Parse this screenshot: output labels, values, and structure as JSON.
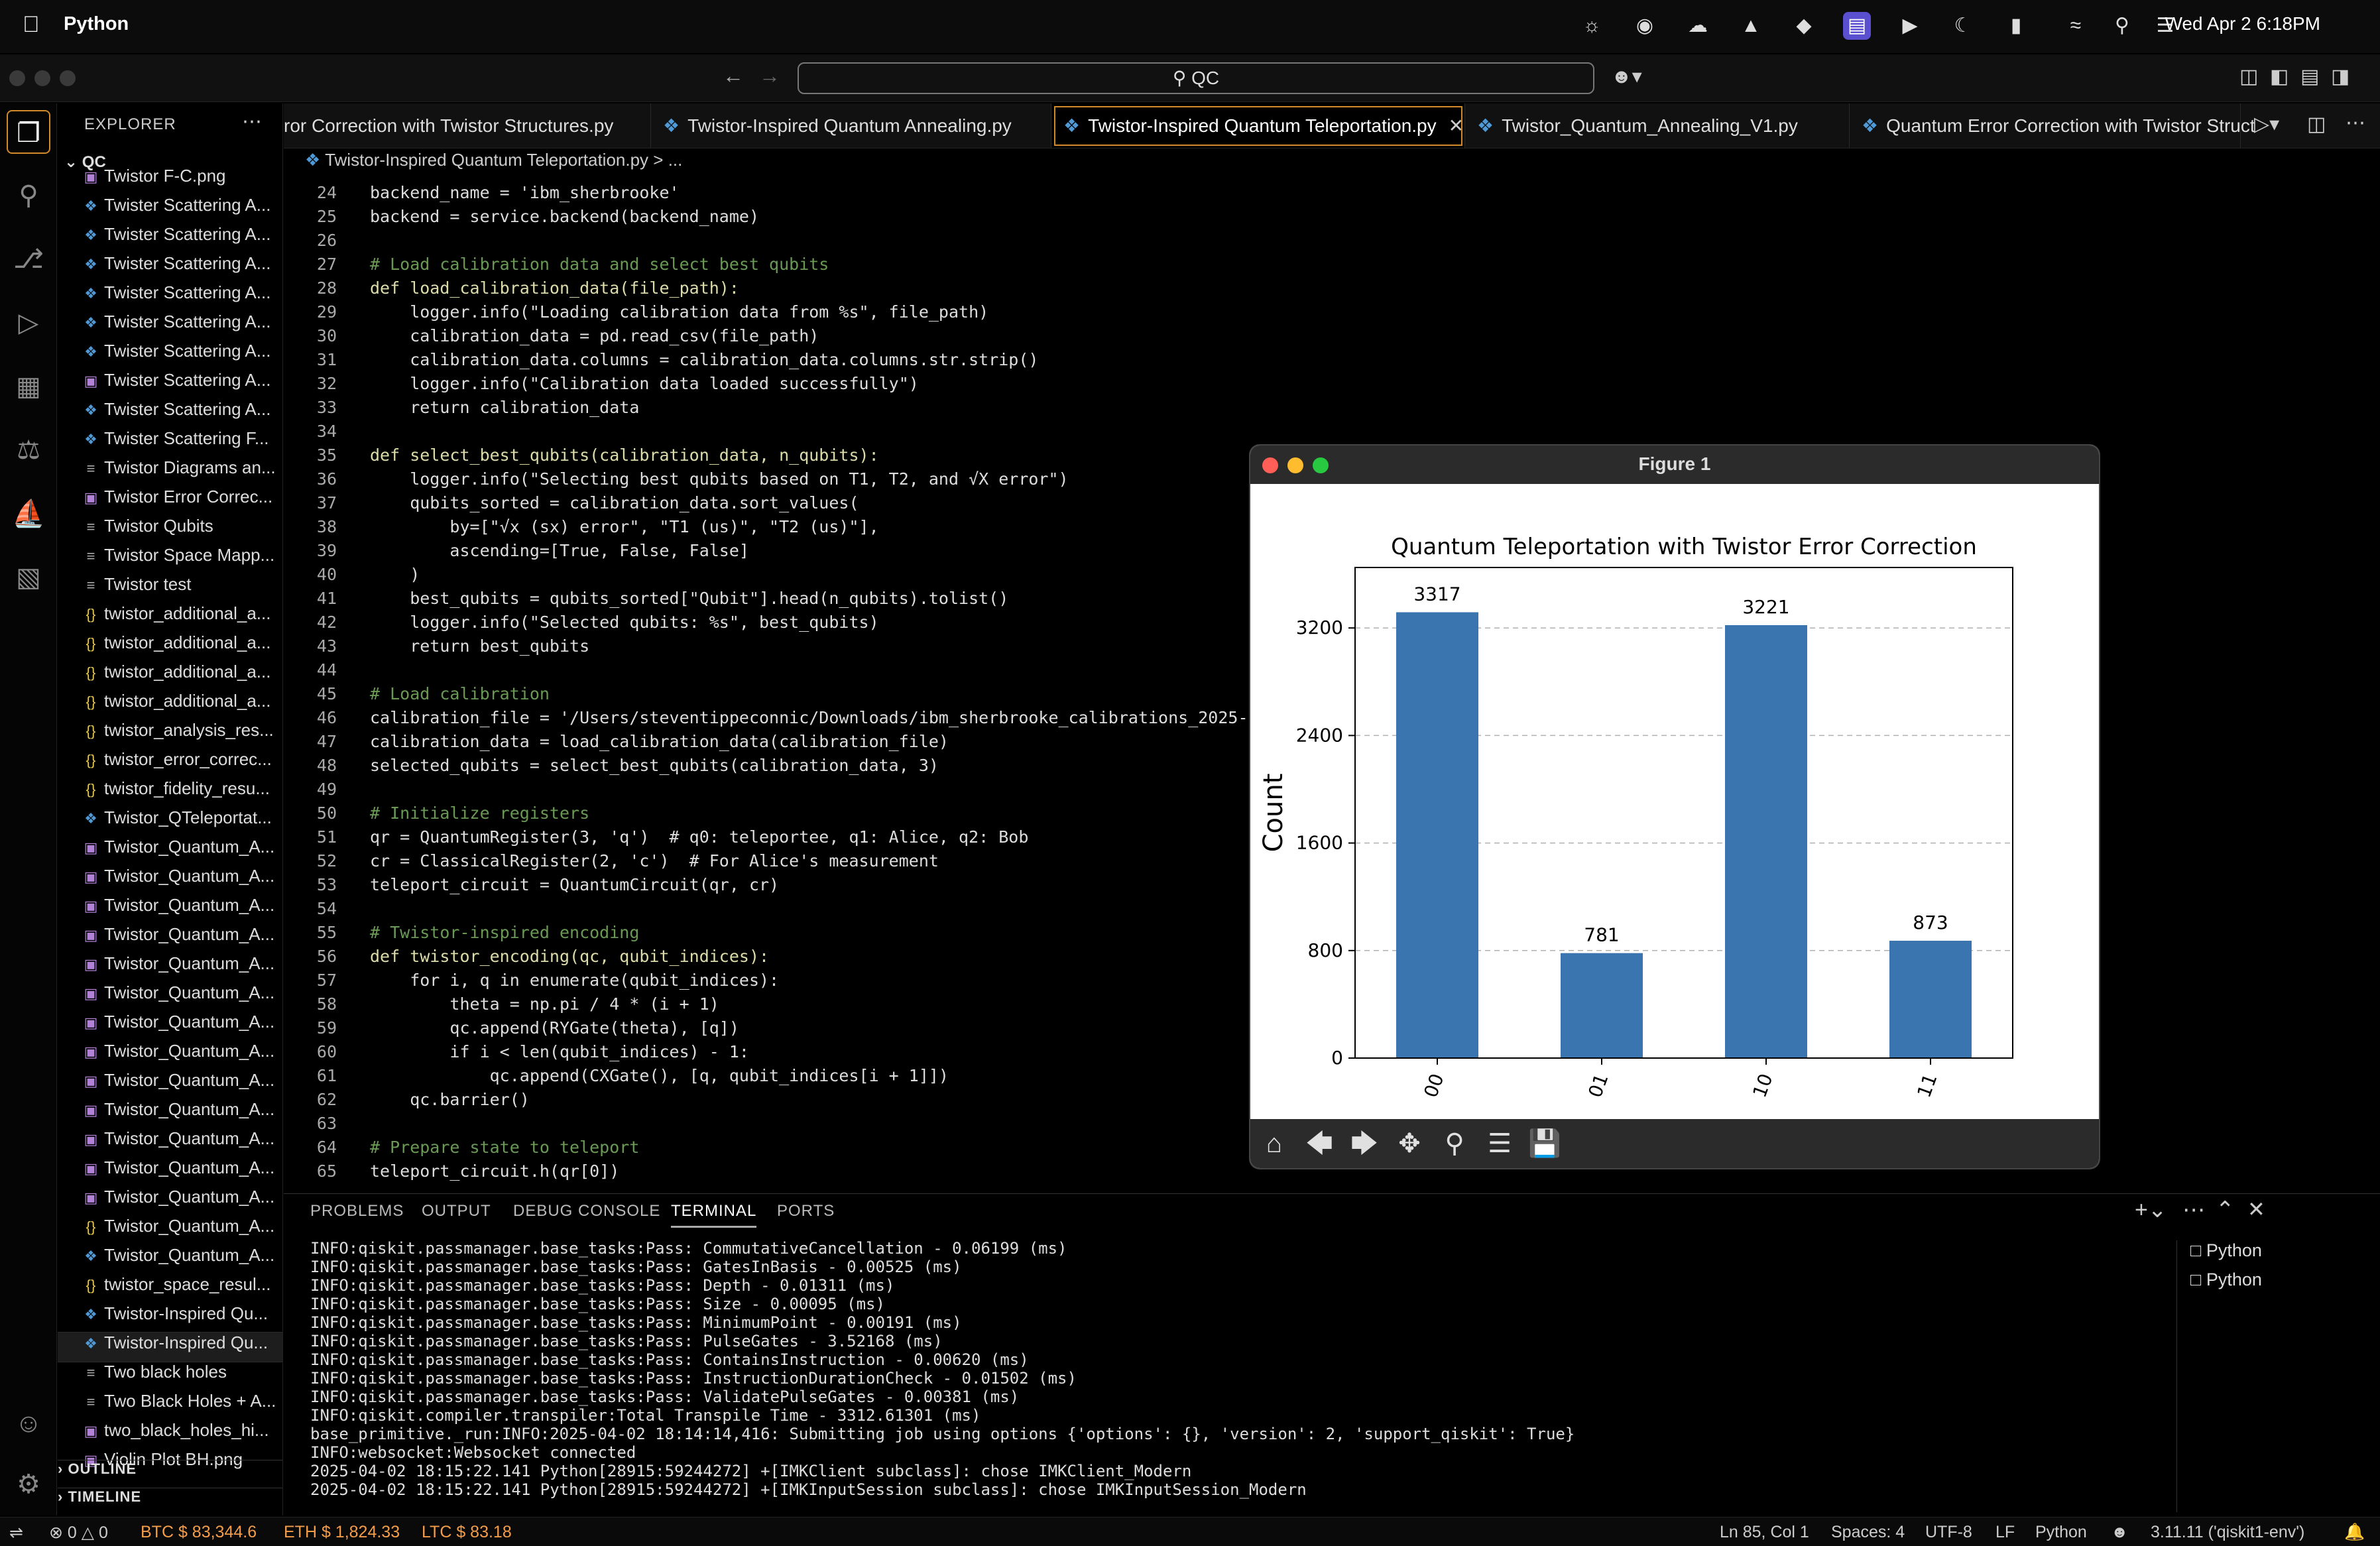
{
  "menubar": {
    "app_name": "Python",
    "clock": "Wed Apr 2  6:18PM"
  },
  "command_center": {
    "query": "QC"
  },
  "explorer": {
    "header": "EXPLORER",
    "root": "QC",
    "files": [
      {
        "name": "Twistor F-C.png",
        "type": "img"
      },
      {
        "name": "Twister Scattering A...",
        "type": "py"
      },
      {
        "name": "Twister Scattering A...",
        "type": "py"
      },
      {
        "name": "Twister Scattering A...",
        "type": "py"
      },
      {
        "name": "Twister Scattering A...",
        "type": "py"
      },
      {
        "name": "Twister Scattering A...",
        "type": "py"
      },
      {
        "name": "Twister Scattering A...",
        "type": "py"
      },
      {
        "name": "Twister Scattering A...",
        "type": "img"
      },
      {
        "name": "Twister Scattering A...",
        "type": "py"
      },
      {
        "name": "Twister Scattering F...",
        "type": "py"
      },
      {
        "name": "Twistor Diagrams an...",
        "type": "txt"
      },
      {
        "name": "Twistor Error Correc...",
        "type": "img"
      },
      {
        "name": "Twistor Qubits",
        "type": "txt"
      },
      {
        "name": "Twistor Space Mapp...",
        "type": "txt"
      },
      {
        "name": "Twistor test",
        "type": "txt"
      },
      {
        "name": "twistor_additional_a...",
        "type": "json"
      },
      {
        "name": "twistor_additional_a...",
        "type": "json"
      },
      {
        "name": "twistor_additional_a...",
        "type": "json"
      },
      {
        "name": "twistor_additional_a...",
        "type": "json"
      },
      {
        "name": "twistor_analysis_res...",
        "type": "json"
      },
      {
        "name": "twistor_error_correc...",
        "type": "json"
      },
      {
        "name": "twistor_fidelity_resu...",
        "type": "json"
      },
      {
        "name": "Twistor_QTeleportat...",
        "type": "py"
      },
      {
        "name": "Twistor_Quantum_A...",
        "type": "img"
      },
      {
        "name": "Twistor_Quantum_A...",
        "type": "img"
      },
      {
        "name": "Twistor_Quantum_A...",
        "type": "img"
      },
      {
        "name": "Twistor_Quantum_A...",
        "type": "img"
      },
      {
        "name": "Twistor_Quantum_A...",
        "type": "img"
      },
      {
        "name": "Twistor_Quantum_A...",
        "type": "img"
      },
      {
        "name": "Twistor_Quantum_A...",
        "type": "img"
      },
      {
        "name": "Twistor_Quantum_A...",
        "type": "img"
      },
      {
        "name": "Twistor_Quantum_A...",
        "type": "img"
      },
      {
        "name": "Twistor_Quantum_A...",
        "type": "img"
      },
      {
        "name": "Twistor_Quantum_A...",
        "type": "img"
      },
      {
        "name": "Twistor_Quantum_A...",
        "type": "img"
      },
      {
        "name": "Twistor_Quantum_A...",
        "type": "img"
      },
      {
        "name": "Twistor_Quantum_A...",
        "type": "json"
      },
      {
        "name": "Twistor_Quantum_A...",
        "type": "py"
      },
      {
        "name": "twistor_space_resul...",
        "type": "json"
      },
      {
        "name": "Twistor-Inspired Qu...",
        "type": "py"
      },
      {
        "name": "Twistor-Inspired Qu...",
        "type": "py",
        "selected": true
      },
      {
        "name": "Two black holes",
        "type": "txt"
      },
      {
        "name": "Two Black Holes + A...",
        "type": "txt"
      },
      {
        "name": "two_black_holes_hi...",
        "type": "img"
      },
      {
        "name": "Violin Plot BH.png",
        "type": "img"
      }
    ],
    "outline_label": "OUTLINE",
    "timeline_label": "TIMELINE"
  },
  "tabs": [
    {
      "label": "ror Correction with Twistor Structures.py",
      "active": false
    },
    {
      "label": "Twistor-Inspired Quantum Annealing.py",
      "active": false
    },
    {
      "label": "Twistor-Inspired Quantum Teleportation.py",
      "active": true
    },
    {
      "label": "Twistor_Quantum_Annealing_V1.py",
      "active": false
    },
    {
      "label": "Quantum Error Correction with Twistor Struct",
      "active": false
    }
  ],
  "breadcrumb": {
    "file": "Twistor-Inspired Quantum Teleportation.py",
    "rest": "> ..."
  },
  "code": [
    {
      "n": "24",
      "t": "backend_name = 'ibm_sherbrooke'"
    },
    {
      "n": "25",
      "t": "backend = service.backend(backend_name)"
    },
    {
      "n": "26",
      "t": ""
    },
    {
      "n": "27",
      "t": "# Load calibration data and select best qubits"
    },
    {
      "n": "28",
      "t": "def load_calibration_data(file_path):"
    },
    {
      "n": "29",
      "t": "    logger.info(\"Loading calibration data from %s\", file_path)"
    },
    {
      "n": "30",
      "t": "    calibration_data = pd.read_csv(file_path)"
    },
    {
      "n": "31",
      "t": "    calibration_data.columns = calibration_data.columns.str.strip()"
    },
    {
      "n": "32",
      "t": "    logger.info(\"Calibration data loaded successfully\")"
    },
    {
      "n": "33",
      "t": "    return calibration_data"
    },
    {
      "n": "34",
      "t": ""
    },
    {
      "n": "35",
      "t": "def select_best_qubits(calibration_data, n_qubits):"
    },
    {
      "n": "36",
      "t": "    logger.info(\"Selecting best qubits based on T1, T2, and √X error\")"
    },
    {
      "n": "37",
      "t": "    qubits_sorted = calibration_data.sort_values("
    },
    {
      "n": "38",
      "t": "        by=[\"√x (sx) error\", \"T1 (us)\", \"T2 (us)\"],"
    },
    {
      "n": "39",
      "t": "        ascending=[True, False, False]"
    },
    {
      "n": "40",
      "t": "    )"
    },
    {
      "n": "41",
      "t": "    best_qubits = qubits_sorted[\"Qubit\"].head(n_qubits).tolist()"
    },
    {
      "n": "42",
      "t": "    logger.info(\"Selected qubits: %s\", best_qubits)"
    },
    {
      "n": "43",
      "t": "    return best_qubits"
    },
    {
      "n": "44",
      "t": ""
    },
    {
      "n": "45",
      "t": "# Load calibration"
    },
    {
      "n": "46",
      "t": "calibration_file = '/Users/steventippeconnic/Downloads/ibm_sherbrooke_calibrations_2025-04-0"
    },
    {
      "n": "47",
      "t": "calibration_data = load_calibration_data(calibration_file)"
    },
    {
      "n": "48",
      "t": "selected_qubits = select_best_qubits(calibration_data, 3)"
    },
    {
      "n": "49",
      "t": ""
    },
    {
      "n": "50",
      "t": "# Initialize registers"
    },
    {
      "n": "51",
      "t": "qr = QuantumRegister(3, 'q')  # q0: teleportee, q1: Alice, q2: Bob"
    },
    {
      "n": "52",
      "t": "cr = ClassicalRegister(2, 'c')  # For Alice's measurement"
    },
    {
      "n": "53",
      "t": "teleport_circuit = QuantumCircuit(qr, cr)"
    },
    {
      "n": "54",
      "t": ""
    },
    {
      "n": "55",
      "t": "# Twistor-inspired encoding"
    },
    {
      "n": "56",
      "t": "def twistor_encoding(qc, qubit_indices):"
    },
    {
      "n": "57",
      "t": "    for i, q in enumerate(qubit_indices):"
    },
    {
      "n": "58",
      "t": "        theta = np.pi / 4 * (i + 1)"
    },
    {
      "n": "59",
      "t": "        qc.append(RYGate(theta), [q])"
    },
    {
      "n": "60",
      "t": "        if i < len(qubit_indices) - 1:"
    },
    {
      "n": "61",
      "t": "            qc.append(CXGate(), [q, qubit_indices[i + 1]])"
    },
    {
      "n": "62",
      "t": "    qc.barrier()"
    },
    {
      "n": "63",
      "t": ""
    },
    {
      "n": "64",
      "t": "# Prepare state to teleport"
    },
    {
      "n": "65",
      "t": "teleport_circuit.h(qr[0])"
    }
  ],
  "figure": {
    "window_title": "Figure 1",
    "chart_data": {
      "type": "bar",
      "title": "Quantum Teleportation with Twistor Error Correction",
      "xlabel": "",
      "ylabel": "Count",
      "categories": [
        "00",
        "01",
        "10",
        "11"
      ],
      "values": [
        3317,
        781,
        3221,
        873
      ],
      "yticks": [
        "0",
        "800",
        "1600",
        "2400",
        "3200"
      ],
      "ylim": [
        0,
        3650
      ],
      "grid": "y-dashed",
      "bar_color": "#3b75af"
    }
  },
  "panel": {
    "tabs": [
      "PROBLEMS",
      "OUTPUT",
      "DEBUG CONSOLE",
      "TERMINAL",
      "PORTS"
    ],
    "active_tab": "TERMINAL",
    "terminal_lines": [
      "INFO:qiskit.passmanager.base_tasks:Pass: CommutativeCancellation - 0.06199 (ms)",
      "INFO:qiskit.passmanager.base_tasks:Pass: GatesInBasis - 0.00525 (ms)",
      "INFO:qiskit.passmanager.base_tasks:Pass: Depth - 0.01311 (ms)",
      "INFO:qiskit.passmanager.base_tasks:Pass: Size - 0.00095 (ms)",
      "INFO:qiskit.passmanager.base_tasks:Pass: MinimumPoint - 0.00191 (ms)",
      "INFO:qiskit.passmanager.base_tasks:Pass: PulseGates - 3.52168 (ms)",
      "INFO:qiskit.passmanager.base_tasks:Pass: ContainsInstruction - 0.00620 (ms)",
      "INFO:qiskit.passmanager.base_tasks:Pass: InstructionDurationCheck - 0.01502 (ms)",
      "INFO:qiskit.passmanager.base_tasks:Pass: ValidatePulseGates - 0.00381 (ms)",
      "INFO:qiskit.compiler.transpiler:Total Transpile Time - 3312.61301 (ms)",
      "base_primitive._run:INFO:2025-04-02 18:14:14,416: Submitting job using options {'options': {}, 'version': 2, 'support_qiskit': True}",
      "INFO:websocket:Websocket connected",
      "2025-04-02 18:15:22.141 Python[28915:59244272] +[IMKClient subclass]: chose IMKClient_Modern",
      "2025-04-02 18:15:22.141 Python[28915:59244272] +[IMKInputSession subclass]: chose IMKInputSession_Modern"
    ],
    "terminals": [
      "Python",
      "Python"
    ]
  },
  "statusbar": {
    "errors": "0",
    "warnings": "0",
    "btc": "BTC $ 83,344.6",
    "eth": "ETH $ 1,824.33",
    "ltc": "LTC $ 83.18",
    "position": "Ln 85, Col 1",
    "spaces": "Spaces: 4",
    "encoding": "UTF-8",
    "eol": "LF",
    "language": "Python",
    "interpreter": "3.11.11 ('qiskit1-env')"
  }
}
